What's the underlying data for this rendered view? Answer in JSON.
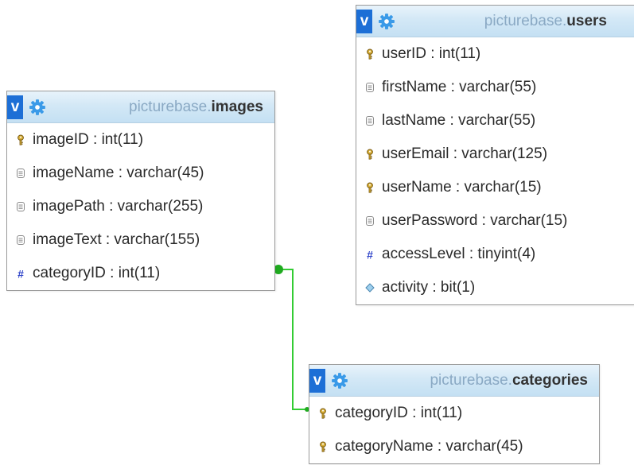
{
  "tables": {
    "images": {
      "db": "picturebase.",
      "name": "images",
      "collapse": "v",
      "columns": [
        {
          "text": "imageID : int(11)",
          "icon": "key-icon"
        },
        {
          "text": "imageName : varchar(45)",
          "icon": "column-icon"
        },
        {
          "text": "imagePath : varchar(255)",
          "icon": "column-icon"
        },
        {
          "text": "imageText : varchar(155)",
          "icon": "column-icon"
        },
        {
          "text": "categoryID : int(11)",
          "icon": "numeric-column-icon"
        }
      ]
    },
    "users": {
      "db": "picturebase.",
      "name": "users",
      "collapse": "v",
      "columns": [
        {
          "text": "userID : int(11)",
          "icon": "key-icon"
        },
        {
          "text": "firstName : varchar(55)",
          "icon": "column-icon"
        },
        {
          "text": "lastName : varchar(55)",
          "icon": "column-icon"
        },
        {
          "text": "userEmail : varchar(125)",
          "icon": "key-icon"
        },
        {
          "text": "userName : varchar(15)",
          "icon": "key-icon"
        },
        {
          "text": "userPassword : varchar(15)",
          "icon": "column-icon"
        },
        {
          "text": "accessLevel : tinyint(4)",
          "icon": "numeric-column-icon"
        },
        {
          "text": "activity : bit(1)",
          "icon": "bit-column-icon"
        }
      ]
    },
    "categories": {
      "db": "picturebase.",
      "name": "categories",
      "collapse": "v",
      "columns": [
        {
          "text": "categoryID : int(11)",
          "icon": "key-icon"
        },
        {
          "text": "categoryName : varchar(45)",
          "icon": "key-icon"
        }
      ]
    }
  },
  "relation": {
    "from": "images.categoryID",
    "to": "categories.categoryID",
    "color": "#33cc33"
  },
  "colors": {
    "collapse_button": "#1d6fd6",
    "db_prefix": "#8aa9c4",
    "header_gradient_top": "#e8f3fb",
    "header_gradient_bottom": "#c4e0f3",
    "key_icon": "#c9a227",
    "hash_icon": "#2f44c9",
    "border": "#9a9a9a"
  }
}
